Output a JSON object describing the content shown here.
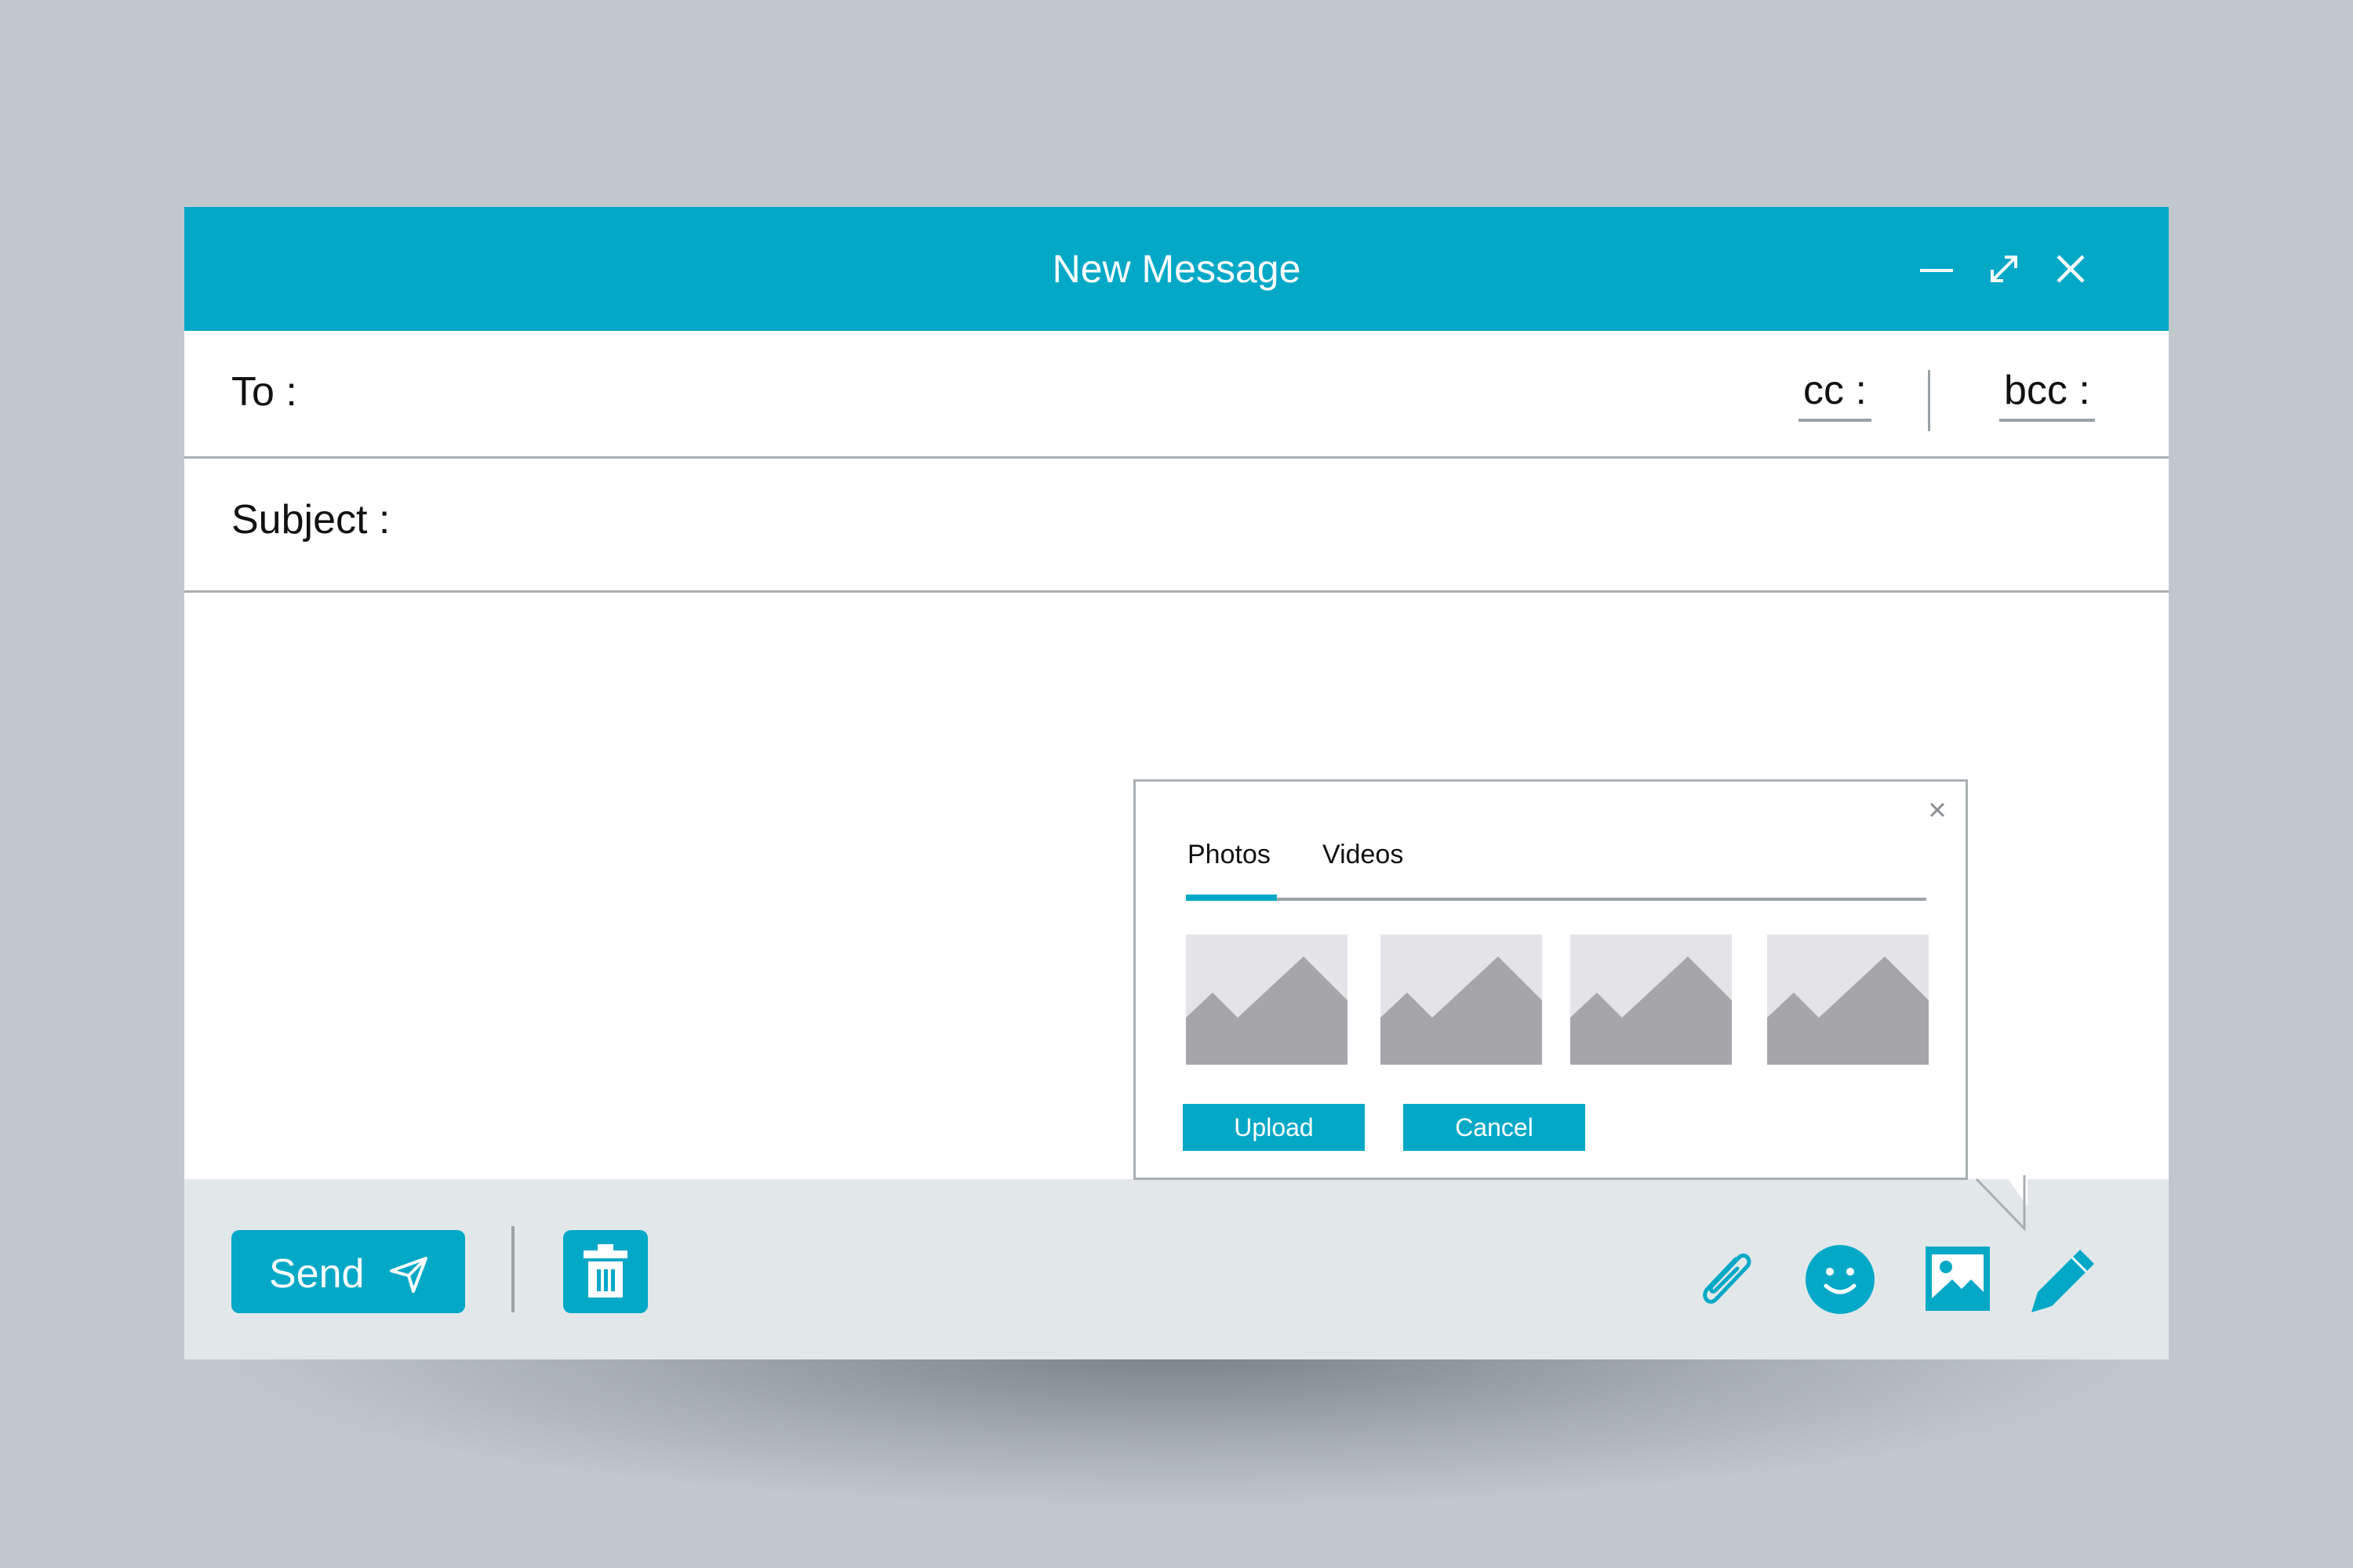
{
  "window": {
    "title": "New Message",
    "controls": [
      "minimize-icon",
      "expand-icon",
      "close-icon"
    ]
  },
  "fields": {
    "to_label": "To :",
    "to_value": "",
    "cc_label": "cc :",
    "bcc_label": "bcc :",
    "subject_label": "Subject :",
    "subject_value": ""
  },
  "body": {
    "value": ""
  },
  "footer": {
    "send_label": "Send",
    "tools": [
      "paperclip-icon",
      "smiley-icon",
      "image-icon",
      "pencil-icon"
    ]
  },
  "media_picker": {
    "tabs": [
      "Photos",
      "Videos"
    ],
    "active_tab": "Photos",
    "thumbnail_count": 4,
    "upload_label": "Upload",
    "cancel_label": "Cancel"
  },
  "colors": {
    "accent": "#03a8c7",
    "background": "#c0c8cb",
    "footer": "#e2e8ea",
    "divider": "#a9afb2",
    "thumbnail_bg": "#e4e4e8",
    "thumbnail_mountain": "#a5a5aa"
  }
}
